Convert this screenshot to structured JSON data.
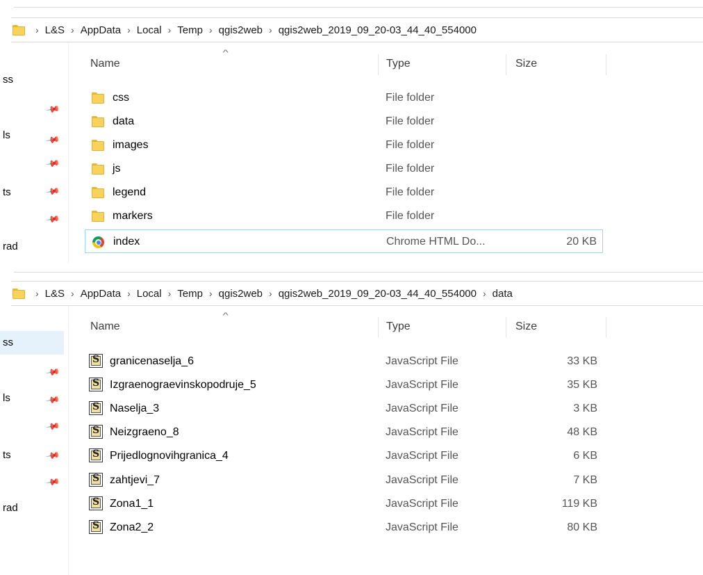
{
  "top_window": {
    "breadcrumb": [
      "L&S",
      "AppData",
      "Local",
      "Temp",
      "qgis2web",
      "qgis2web_2019_09_20-03_44_40_554000"
    ],
    "nav_items": [
      "ss",
      "ls",
      "ts",
      "rad"
    ],
    "columns": {
      "name": "Name",
      "type": "Type",
      "size": "Size"
    },
    "files": [
      {
        "name": "css",
        "type": "File folder",
        "size": "",
        "icon": "folder-icon"
      },
      {
        "name": "data",
        "type": "File folder",
        "size": "",
        "icon": "folder-icon"
      },
      {
        "name": "images",
        "type": "File folder",
        "size": "",
        "icon": "folder-icon"
      },
      {
        "name": "js",
        "type": "File folder",
        "size": "",
        "icon": "folder-icon"
      },
      {
        "name": "legend",
        "type": "File folder",
        "size": "",
        "icon": "folder-icon"
      },
      {
        "name": "markers",
        "type": "File folder",
        "size": "",
        "icon": "folder-icon"
      },
      {
        "name": "index",
        "type": "Chrome HTML Do...",
        "size": "20 KB",
        "icon": "chrome-icon"
      }
    ]
  },
  "bottom_window": {
    "breadcrumb": [
      "L&S",
      "AppData",
      "Local",
      "Temp",
      "qgis2web",
      "qgis2web_2019_09_20-03_44_40_554000",
      "data"
    ],
    "nav_items": [
      "ss",
      "ls",
      "ts",
      "rad"
    ],
    "columns": {
      "name": "Name",
      "type": "Type",
      "size": "Size"
    },
    "files": [
      {
        "name": "granicenaselja_6",
        "type": "JavaScript File",
        "size": "33 KB"
      },
      {
        "name": "Izgraenograevinskopodruje_5",
        "type": "JavaScript File",
        "size": "35 KB"
      },
      {
        "name": "Naselja_3",
        "type": "JavaScript File",
        "size": "3 KB"
      },
      {
        "name": "Neizgraeno_8",
        "type": "JavaScript File",
        "size": "48 KB"
      },
      {
        "name": "Prijedlognovihgranica_4",
        "type": "JavaScript File",
        "size": "6 KB"
      },
      {
        "name": "zahtjevi_7",
        "type": "JavaScript File",
        "size": "7 KB"
      },
      {
        "name": "Zona1_1",
        "type": "JavaScript File",
        "size": "119 KB"
      },
      {
        "name": "Zona2_2",
        "type": "JavaScript File",
        "size": "80 KB"
      }
    ]
  },
  "colors": {
    "selection": "#e5f1fb",
    "focus_border": "#99d1ff",
    "folder": "#f8d35b"
  }
}
